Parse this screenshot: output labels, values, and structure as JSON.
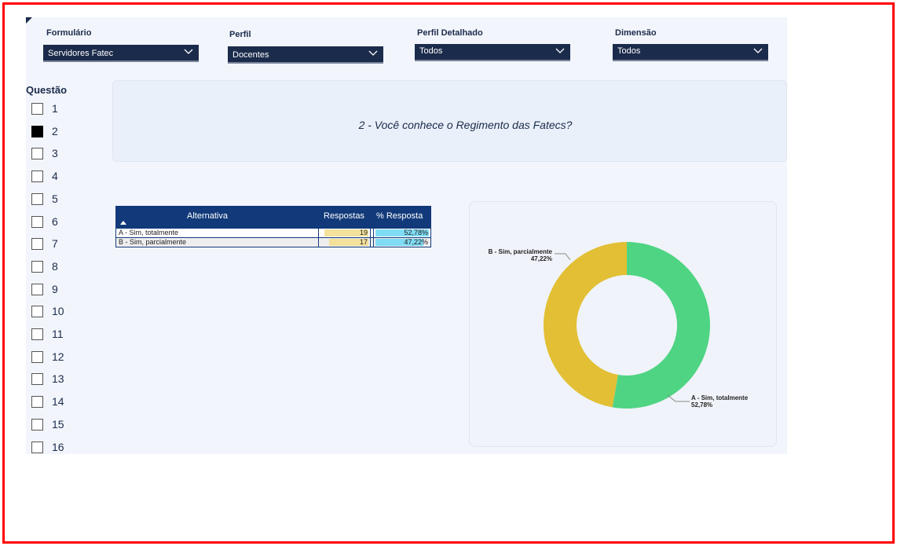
{
  "filters": {
    "formulario": {
      "label": "Formulário",
      "value": "Servidores Fatec"
    },
    "perfil": {
      "label": "Perfil",
      "value": "Docentes"
    },
    "perfil_detalhado": {
      "label": "Perfil Detalhado",
      "value": "Todos"
    },
    "dimensao": {
      "label": "Dimensão",
      "value": "Todos"
    }
  },
  "questions": {
    "title": "Questão",
    "items": [
      "1",
      "2",
      "3",
      "4",
      "5",
      "6",
      "7",
      "8",
      "9",
      "10",
      "11",
      "12",
      "13",
      "14",
      "15",
      "16"
    ],
    "selected": "2"
  },
  "question_text": "2 - Você conhece o Regimento das Fatecs?",
  "table": {
    "headers": {
      "alternativa": "Alternativa",
      "respostas": "Respostas",
      "pct": "% Resposta"
    },
    "rows": [
      {
        "alternativa": "A - Sim, totalmente",
        "respostas": "19",
        "pct": "52,78%",
        "pct_value": 0.5278,
        "resp_value": 19
      },
      {
        "alternativa": "B - Sim, parcialmente",
        "respostas": "17",
        "pct": "47,22%",
        "pct_value": 0.4722,
        "resp_value": 17
      }
    ]
  },
  "chart_data": {
    "type": "pie",
    "donut": true,
    "series": [
      {
        "name": "A - Sim, totalmente",
        "value": 52.78,
        "label": "52,78%",
        "color": "#4fd483"
      },
      {
        "name": "B - Sim, parcialmente",
        "value": 47.22,
        "label": "47,22%",
        "color": "#e2bf34"
      }
    ]
  },
  "colors": {
    "navy": "#1b2b4b",
    "table_header": "#123a7a"
  }
}
